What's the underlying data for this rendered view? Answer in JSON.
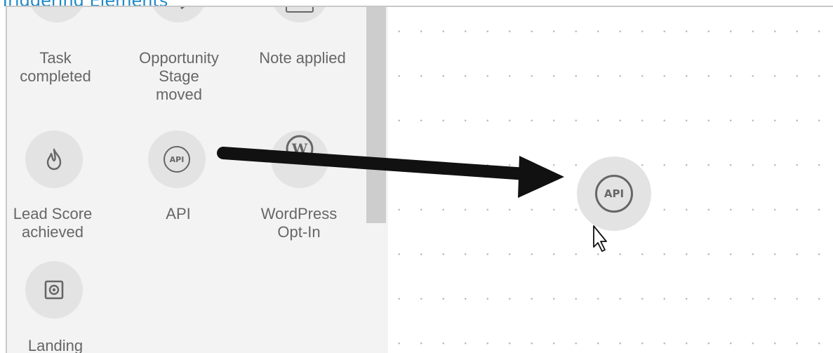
{
  "header": {
    "title": "Triggering Elements"
  },
  "palette": {
    "items": [
      {
        "label": "Task\ncompleted",
        "icon": "check-circle-icon"
      },
      {
        "label": "Opportunity\nStage\nmoved",
        "icon": "arrow-right-icon"
      },
      {
        "label": "Note applied",
        "icon": "note-icon"
      },
      {
        "label": "Lead Score\nachieved",
        "icon": "flame-icon"
      },
      {
        "label": "API",
        "icon": "api-icon",
        "badge": "API"
      },
      {
        "label": "WordPress\nOpt-In",
        "icon": "wordpress-icon"
      },
      {
        "label": "Landing",
        "icon": "landing-page-icon"
      }
    ]
  },
  "canvas": {
    "dropped_node": {
      "badge": "API",
      "icon": "api-icon"
    }
  },
  "colors": {
    "panel_bg": "#f3f3f3",
    "circle_bg": "#e3e3e3",
    "label": "#666666",
    "title": "#1e88c8"
  }
}
